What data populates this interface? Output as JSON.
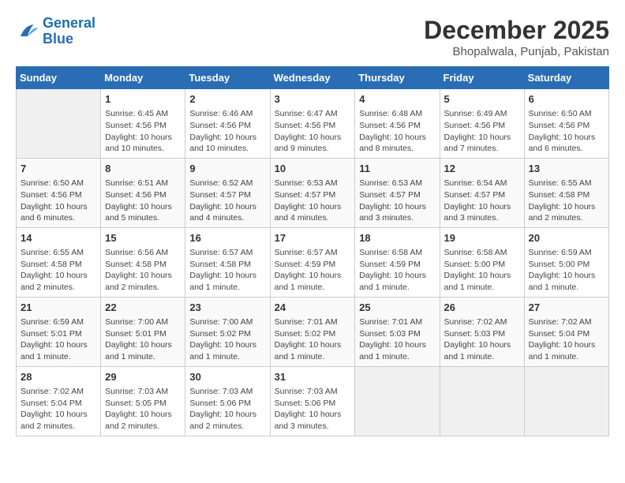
{
  "logo": {
    "line1": "General",
    "line2": "Blue"
  },
  "title": "December 2025",
  "subtitle": "Bhopalwala, Punjab, Pakistan",
  "days_header": [
    "Sunday",
    "Monday",
    "Tuesday",
    "Wednesday",
    "Thursday",
    "Friday",
    "Saturday"
  ],
  "weeks": [
    [
      {
        "num": "",
        "info": ""
      },
      {
        "num": "1",
        "info": "Sunrise: 6:45 AM\nSunset: 4:56 PM\nDaylight: 10 hours\nand 10 minutes."
      },
      {
        "num": "2",
        "info": "Sunrise: 6:46 AM\nSunset: 4:56 PM\nDaylight: 10 hours\nand 10 minutes."
      },
      {
        "num": "3",
        "info": "Sunrise: 6:47 AM\nSunset: 4:56 PM\nDaylight: 10 hours\nand 9 minutes."
      },
      {
        "num": "4",
        "info": "Sunrise: 6:48 AM\nSunset: 4:56 PM\nDaylight: 10 hours\nand 8 minutes."
      },
      {
        "num": "5",
        "info": "Sunrise: 6:49 AM\nSunset: 4:56 PM\nDaylight: 10 hours\nand 7 minutes."
      },
      {
        "num": "6",
        "info": "Sunrise: 6:50 AM\nSunset: 4:56 PM\nDaylight: 10 hours\nand 6 minutes."
      }
    ],
    [
      {
        "num": "7",
        "info": "Sunrise: 6:50 AM\nSunset: 4:56 PM\nDaylight: 10 hours\nand 6 minutes."
      },
      {
        "num": "8",
        "info": "Sunrise: 6:51 AM\nSunset: 4:56 PM\nDaylight: 10 hours\nand 5 minutes."
      },
      {
        "num": "9",
        "info": "Sunrise: 6:52 AM\nSunset: 4:57 PM\nDaylight: 10 hours\nand 4 minutes."
      },
      {
        "num": "10",
        "info": "Sunrise: 6:53 AM\nSunset: 4:57 PM\nDaylight: 10 hours\nand 4 minutes."
      },
      {
        "num": "11",
        "info": "Sunrise: 6:53 AM\nSunset: 4:57 PM\nDaylight: 10 hours\nand 3 minutes."
      },
      {
        "num": "12",
        "info": "Sunrise: 6:54 AM\nSunset: 4:57 PM\nDaylight: 10 hours\nand 3 minutes."
      },
      {
        "num": "13",
        "info": "Sunrise: 6:55 AM\nSunset: 4:58 PM\nDaylight: 10 hours\nand 2 minutes."
      }
    ],
    [
      {
        "num": "14",
        "info": "Sunrise: 6:55 AM\nSunset: 4:58 PM\nDaylight: 10 hours\nand 2 minutes."
      },
      {
        "num": "15",
        "info": "Sunrise: 6:56 AM\nSunset: 4:58 PM\nDaylight: 10 hours\nand 2 minutes."
      },
      {
        "num": "16",
        "info": "Sunrise: 6:57 AM\nSunset: 4:58 PM\nDaylight: 10 hours\nand 1 minute."
      },
      {
        "num": "17",
        "info": "Sunrise: 6:57 AM\nSunset: 4:59 PM\nDaylight: 10 hours\nand 1 minute."
      },
      {
        "num": "18",
        "info": "Sunrise: 6:58 AM\nSunset: 4:59 PM\nDaylight: 10 hours\nand 1 minute."
      },
      {
        "num": "19",
        "info": "Sunrise: 6:58 AM\nSunset: 5:00 PM\nDaylight: 10 hours\nand 1 minute."
      },
      {
        "num": "20",
        "info": "Sunrise: 6:59 AM\nSunset: 5:00 PM\nDaylight: 10 hours\nand 1 minute."
      }
    ],
    [
      {
        "num": "21",
        "info": "Sunrise: 6:59 AM\nSunset: 5:01 PM\nDaylight: 10 hours\nand 1 minute."
      },
      {
        "num": "22",
        "info": "Sunrise: 7:00 AM\nSunset: 5:01 PM\nDaylight: 10 hours\nand 1 minute."
      },
      {
        "num": "23",
        "info": "Sunrise: 7:00 AM\nSunset: 5:02 PM\nDaylight: 10 hours\nand 1 minute."
      },
      {
        "num": "24",
        "info": "Sunrise: 7:01 AM\nSunset: 5:02 PM\nDaylight: 10 hours\nand 1 minute."
      },
      {
        "num": "25",
        "info": "Sunrise: 7:01 AM\nSunset: 5:03 PM\nDaylight: 10 hours\nand 1 minute."
      },
      {
        "num": "26",
        "info": "Sunrise: 7:02 AM\nSunset: 5:03 PM\nDaylight: 10 hours\nand 1 minute."
      },
      {
        "num": "27",
        "info": "Sunrise: 7:02 AM\nSunset: 5:04 PM\nDaylight: 10 hours\nand 1 minute."
      }
    ],
    [
      {
        "num": "28",
        "info": "Sunrise: 7:02 AM\nSunset: 5:04 PM\nDaylight: 10 hours\nand 2 minutes."
      },
      {
        "num": "29",
        "info": "Sunrise: 7:03 AM\nSunset: 5:05 PM\nDaylight: 10 hours\nand 2 minutes."
      },
      {
        "num": "30",
        "info": "Sunrise: 7:03 AM\nSunset: 5:06 PM\nDaylight: 10 hours\nand 2 minutes."
      },
      {
        "num": "31",
        "info": "Sunrise: 7:03 AM\nSunset: 5:06 PM\nDaylight: 10 hours\nand 3 minutes."
      },
      {
        "num": "",
        "info": ""
      },
      {
        "num": "",
        "info": ""
      },
      {
        "num": "",
        "info": ""
      }
    ]
  ]
}
